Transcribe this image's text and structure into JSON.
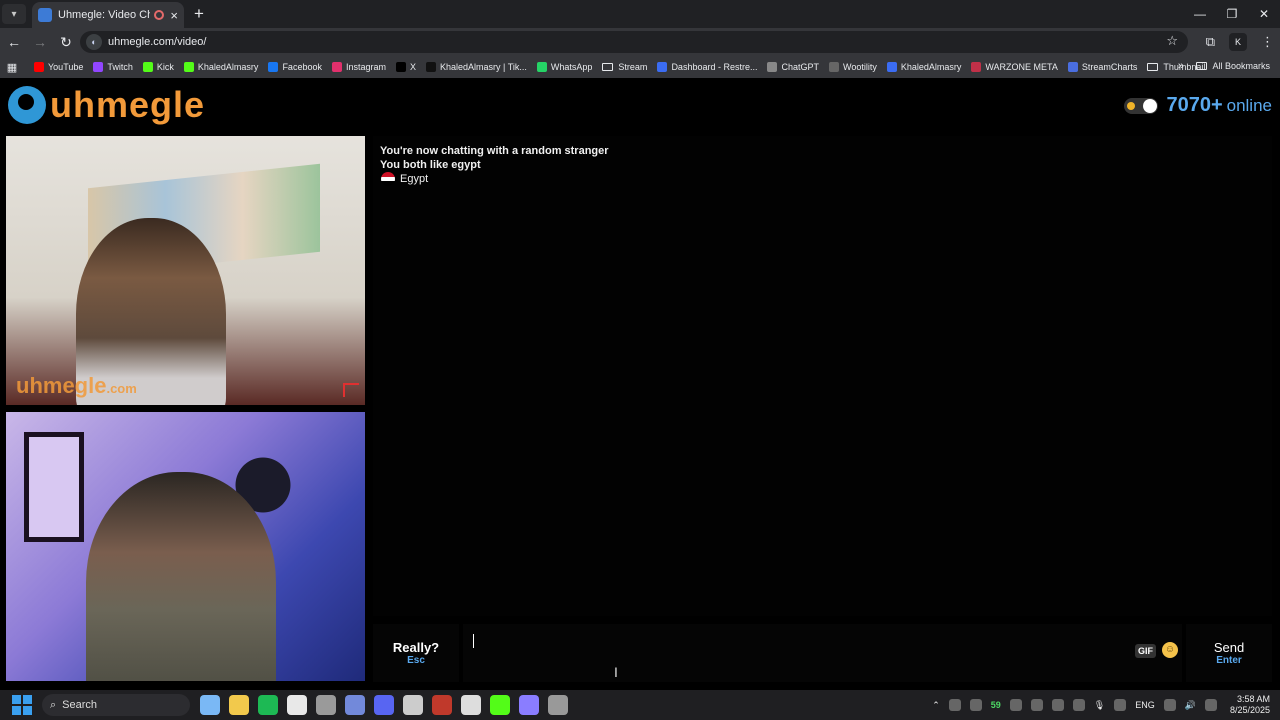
{
  "browser": {
    "tab": {
      "title": "Uhmegle: Video Chat | Ome",
      "close": "×"
    },
    "new_tab": "+",
    "url": "uhmegle.com/video/",
    "bookmarks": [
      {
        "label": "YouTube",
        "color": "#ff0000"
      },
      {
        "label": "Twitch",
        "color": "#9146ff"
      },
      {
        "label": "Kick",
        "color": "#53fc18"
      },
      {
        "label": "KhaledAlmasry",
        "color": "#53fc18"
      },
      {
        "label": "Facebook",
        "color": "#1877f2"
      },
      {
        "label": "Instagram",
        "color": "#e1306c"
      },
      {
        "label": "X",
        "color": "#000000"
      },
      {
        "label": "KhaledAlmasry | Tik...",
        "color": "#111111"
      },
      {
        "label": "WhatsApp",
        "color": "#25d366"
      },
      {
        "label": "Stream",
        "color": "folder"
      },
      {
        "label": "Dashboard - Restre...",
        "color": "#3b6cf2"
      },
      {
        "label": "ChatGPT",
        "color": "#888888"
      },
      {
        "label": "Wootility",
        "color": "#666666"
      },
      {
        "label": "KhaledAlmasry",
        "color": "#3b6cf2"
      },
      {
        "label": "WARZONE META",
        "color": "#c03048"
      },
      {
        "label": "StreamCharts",
        "color": "#4a6ee0"
      },
      {
        "label": "Thumbnail",
        "color": "folder"
      }
    ],
    "all_bookmarks": "All Bookmarks"
  },
  "site": {
    "logo_text": "uhmegle",
    "online_count": "7070+",
    "online_label": "online",
    "watermark": "uhmegle",
    "watermark_suffix": ".com"
  },
  "chat": {
    "status_line": "You're now chatting with a random stranger",
    "interest_line": "You both like egypt",
    "country": "Egypt"
  },
  "controls": {
    "esc_label": "Really?",
    "esc_hint": "Esc",
    "gif_label": "GIF",
    "send_label": "Send",
    "send_hint": "Enter"
  },
  "taskbar": {
    "search_label": "Search",
    "counter": "59",
    "lang": "ENG",
    "time": "3:58 AM",
    "date": "8/25/2025",
    "app_colors": [
      "#7ab8f5",
      "#f2c94c",
      "#1db954",
      "#e8e8e8",
      "#9a9a9a",
      "#7289da",
      "#5865f2",
      "#cccccc",
      "#c0392b",
      "#dddddd",
      "#53fc18",
      "#8a7dff",
      "#999999"
    ]
  }
}
